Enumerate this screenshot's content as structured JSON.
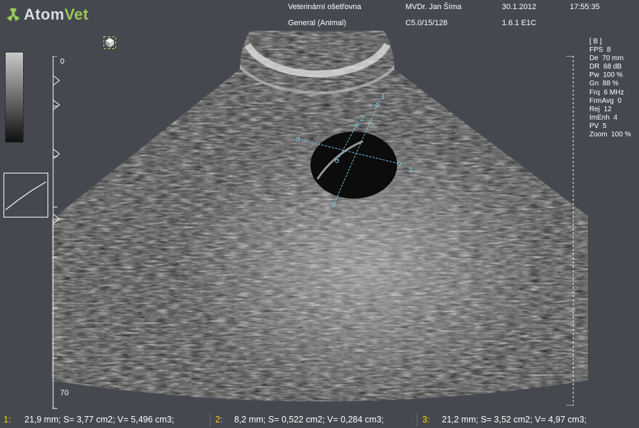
{
  "header": {
    "logo_text_a": "Atom",
    "logo_text_b": "Vet",
    "exam_type": "Veterinární ošetřovna",
    "preset": "General (Animal)",
    "doctor": "MVDr. Jan Šíma",
    "probe": "C5.0/15/128",
    "date": "30.1.2012",
    "version": "1.6.1  E1C",
    "time": "17:55:35"
  },
  "depth_scale": {
    "top_label": "0",
    "bottom_label": "70"
  },
  "params": {
    "mode": "[ B ]",
    "items": [
      {
        "key": "FPS",
        "value": "8"
      },
      {
        "key": "De",
        "value": "70 mm"
      },
      {
        "key": "DR",
        "value": "68 dB"
      },
      {
        "key": "Pw",
        "value": "100 %"
      },
      {
        "key": "Gn",
        "value": "88 %"
      },
      {
        "key": "Frq",
        "value": "6 MHz"
      },
      {
        "key": "FrmAvg",
        "value": "0"
      },
      {
        "key": "Rej",
        "value": "12"
      },
      {
        "key": "ImEnh",
        "value": "4"
      },
      {
        "key": "PV",
        "value": "5"
      },
      {
        "key": "Zoom",
        "value": "100 %"
      }
    ]
  },
  "measure_labels": [
    "1",
    "2",
    "3"
  ],
  "measurements": [
    {
      "index": "1:",
      "text": "21,9 mm; S= 3,77 cm2; V= 5,496 cm3;"
    },
    {
      "index": "2:",
      "text": "8,2 mm; S= 0,522 cm2; V= 0,284 cm3;"
    },
    {
      "index": "3:",
      "text": "21,2 mm; S= 3,52 cm2; V= 4,97 cm3;"
    }
  ],
  "colors": {
    "background": "#45494f",
    "measure_index": "#ffd700",
    "caliper": "#7ecbe8",
    "logo_accent": "#9bc85a"
  },
  "icons": [
    "atomvet-logo-icon",
    "cube-icon",
    "focus-marker-icon"
  ]
}
